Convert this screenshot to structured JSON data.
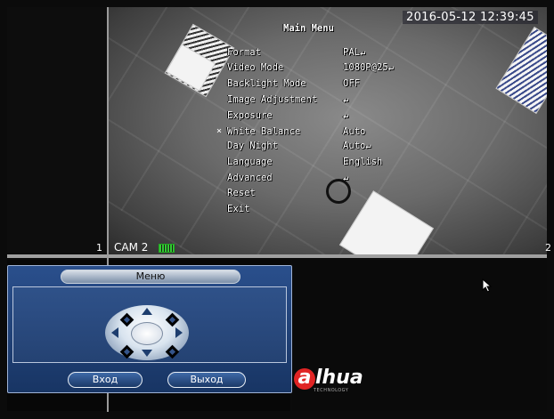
{
  "camera_view": {
    "timestamp": "2016-05-12 12:39:45",
    "menu_title": "Main Menu",
    "menu_items": [
      {
        "label": "Format",
        "value": "PAL↵"
      },
      {
        "label": "Video Mode",
        "value": "1080P@25↵"
      },
      {
        "label": "Backlight Mode",
        "value": "OFF"
      },
      {
        "label": "Image Adjustment",
        "value": "↵"
      },
      {
        "label": "Exposure",
        "value": "↵"
      },
      {
        "label": "White Balance",
        "value": "Auto"
      },
      {
        "label": "Day Night",
        "value": "Auto↵"
      },
      {
        "label": "Language",
        "value": "English"
      },
      {
        "label": "Advanced",
        "value": "↵"
      },
      {
        "label": "Reset",
        "value": ""
      },
      {
        "label": "Exit",
        "value": ""
      }
    ],
    "selected_item_index": 5,
    "channel_left": "1",
    "channel_right": "2",
    "camera_label": "CAM 2"
  },
  "ptz_panel": {
    "title": "Меню",
    "enter_label": "Вход",
    "exit_label": "Выход"
  },
  "brand": {
    "logo_a": "a",
    "logo_rest": "lhua",
    "logo_sub": "TECHNOLOGY"
  },
  "colors": {
    "panel_blue": "#2a4f8c",
    "logo_red": "#e02424",
    "battery_green": "#33cc33"
  }
}
